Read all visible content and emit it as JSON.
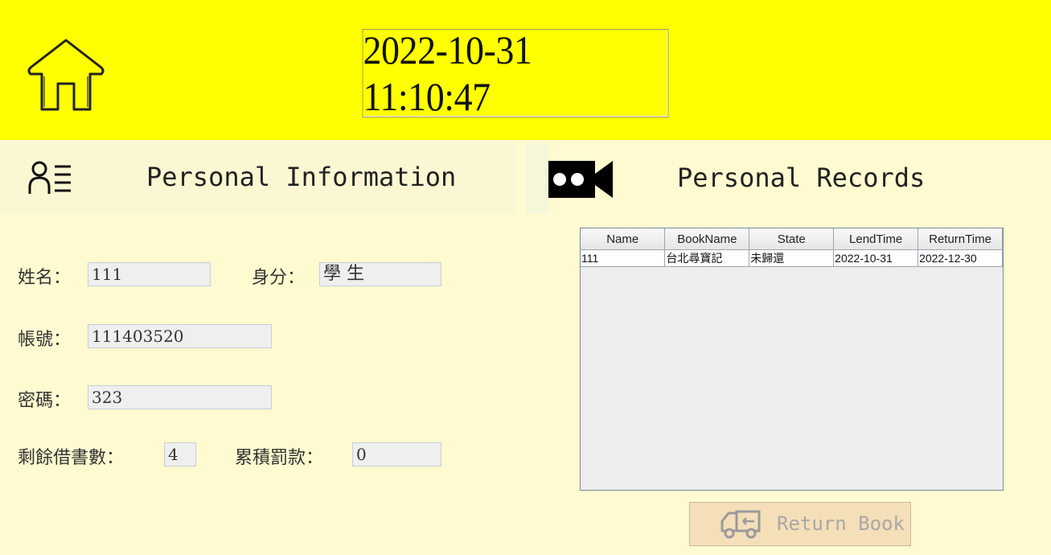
{
  "header": {
    "datetime": "2022-10-31 11:10:47"
  },
  "icons": {
    "home": "home-icon",
    "profile": "profile-list-icon",
    "records": "video-camera-icon",
    "return": "return-truck-icon"
  },
  "personal_info": {
    "title": "Personal Information",
    "name_label": "姓名：",
    "name_value": "111",
    "identity_label": "身分：",
    "identity_value": "學 生",
    "account_label": "帳號：",
    "account_value": "111403520",
    "password_label": "密碼：",
    "password_value": "323",
    "remaining_label": "剩餘借書數：",
    "remaining_value": "4",
    "fine_label": "累積罰款：",
    "fine_value": "0"
  },
  "personal_records": {
    "title": "Personal Records",
    "columns": [
      "Name",
      "BookName",
      "State",
      "LendTime",
      "ReturnTime"
    ],
    "rows": [
      [
        "111",
        "台北尋寶記",
        "未歸還",
        "2022-10-31",
        "2022-12-30"
      ]
    ],
    "return_button": "Return Book"
  },
  "colors": {
    "header_bg": "#ffff00",
    "page_bg": "#fffad0",
    "button_bg": "#f5dfb8"
  }
}
